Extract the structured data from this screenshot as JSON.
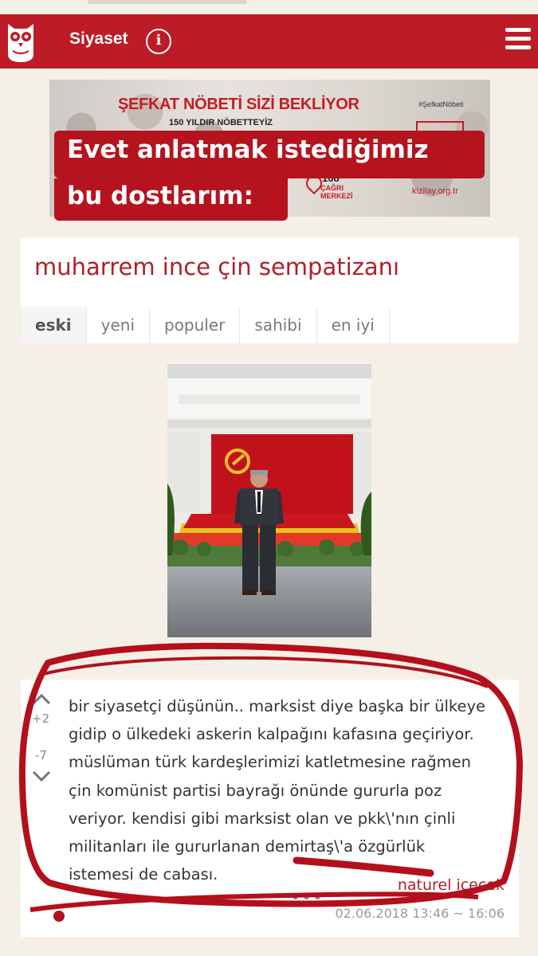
{
  "header": {
    "title": "Siyaset",
    "info_icon": "info-icon",
    "menu_icon": "hamburger-menu-icon",
    "logo_icon": "owl-logo-icon"
  },
  "ad": {
    "headline": "ŞEFKAT NÖBETİ SİZİ BEKLİYOR",
    "subline": "150 YILDIR NÖBETTEYİZ",
    "hashtag": "#ŞefkatNöbeti",
    "number": "168",
    "cagri": "ÇAĞRI MERKEZİ",
    "site": "kizilay.org.tr"
  },
  "caption": {
    "line1": "Evet anlatmak istediğimiz",
    "line2": "bu dostlarım:"
  },
  "topic": {
    "title": "muharrem ince çin sempatizanı",
    "tabs": [
      "eski",
      "yeni",
      "populer",
      "sahibi",
      "en iyi"
    ],
    "active_tab": "eski"
  },
  "entry": {
    "upvotes": "+2",
    "downvotes": "-7",
    "lines": [
      "bir siyasetçi düşünün.. marksist diye başka bir ülkeye",
      "gidip o ülkedeki askerin kalpağını kafasına geçiriyor.",
      "müslüman türk kardeşlerimizi katletmesine rağmen",
      "çin komünist partisi bayrağı önünde gururla poz",
      "veriyor. kendisi gibi marksist olan ve pkk\\'nın çinli",
      "militanları ile gururlanan demirtaş\\'a özgürlük",
      "istemesi de cabası."
    ],
    "author": "naturel icecek",
    "more": "•••",
    "date": "02.06.2018 13:46 ~ 16:06"
  },
  "colors": {
    "brand": "#bd1b26",
    "background": "#f4efe7",
    "author": "#b0202a",
    "marker": "#b3101c"
  }
}
